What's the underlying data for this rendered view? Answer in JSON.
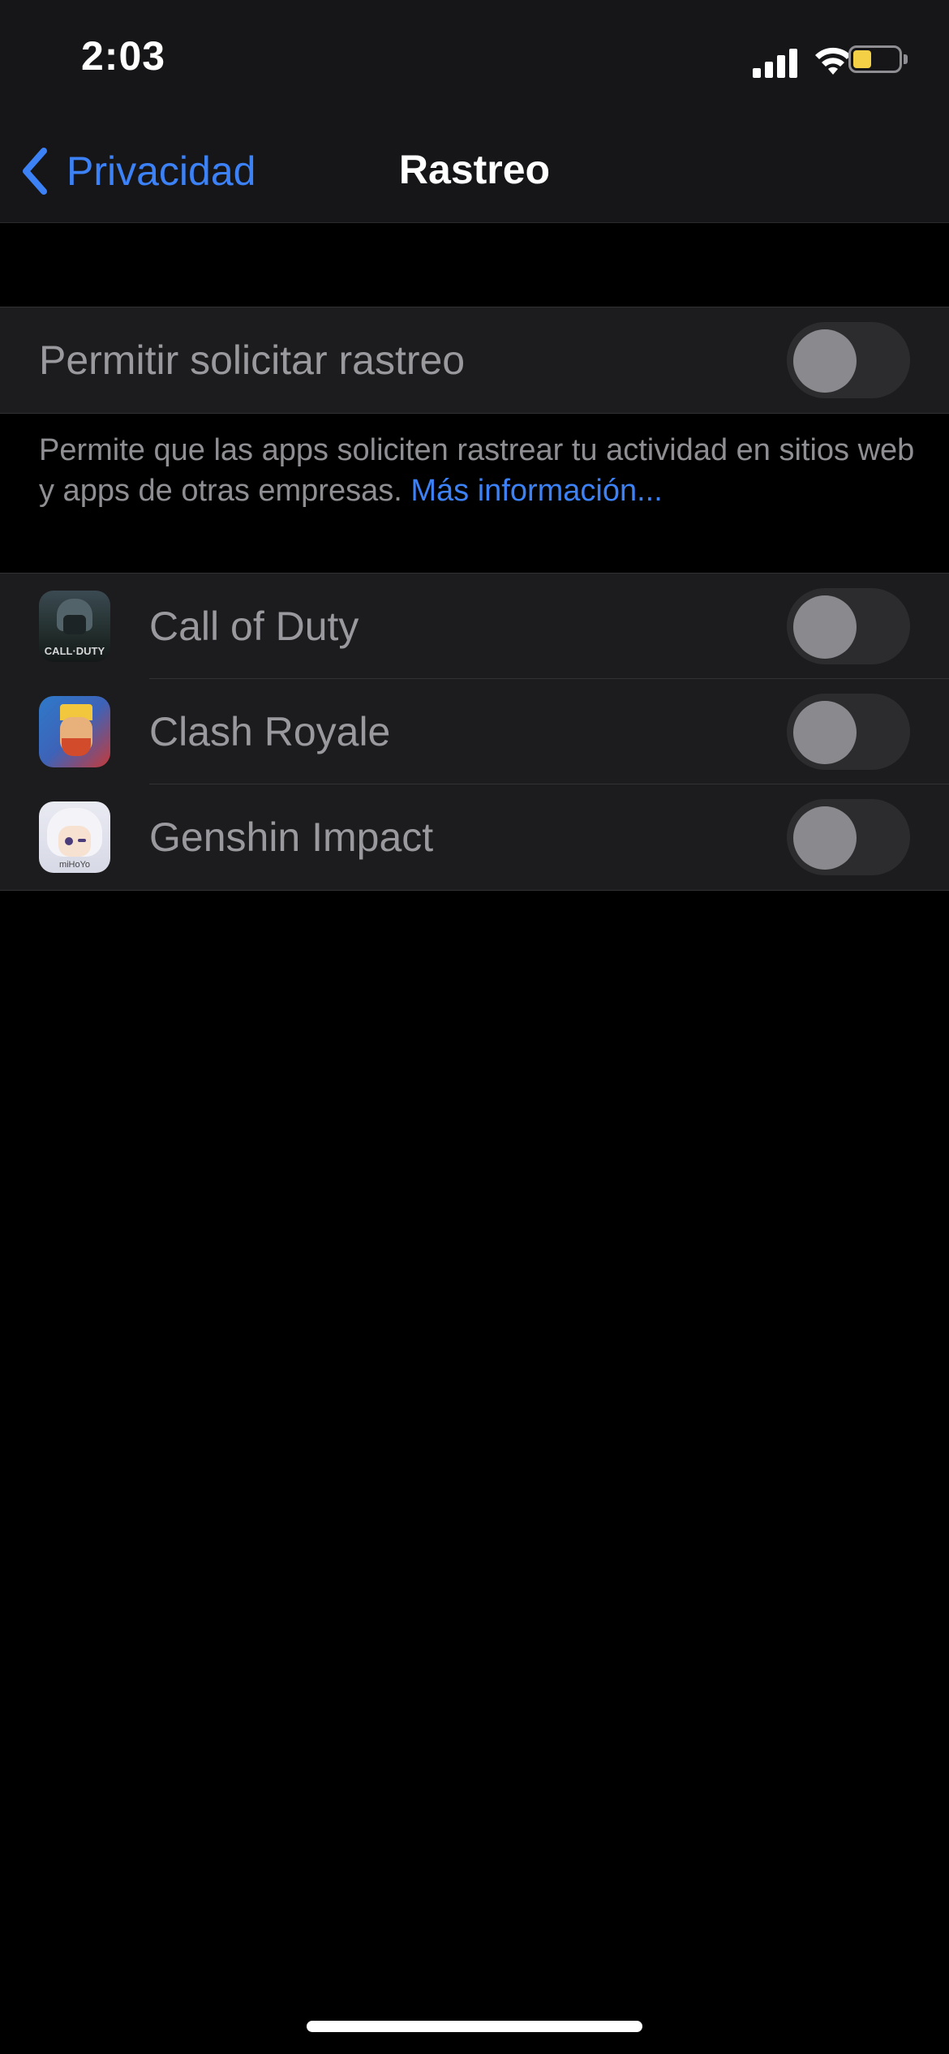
{
  "status_bar": {
    "time": "2:03",
    "icons": [
      "cellular-signal-icon",
      "wifi-icon",
      "battery-icon"
    ],
    "battery_color": "#f4d046"
  },
  "nav": {
    "back_label": "Privacidad",
    "title": "Rastreo",
    "accent_color": "#3c82f6"
  },
  "main_setting": {
    "label": "Permitir solicitar rastreo",
    "enabled": false
  },
  "footer": {
    "text": "Permite que las apps soliciten rastrear tu actividad en sitios web y apps de otras empresas.",
    "link": "Más información..."
  },
  "apps": [
    {
      "name": "Call of Duty",
      "icon": "call-of-duty-app-icon",
      "icon_text": "CALL·DUTY",
      "enabled": false
    },
    {
      "name": "Clash Royale",
      "icon": "clash-royale-app-icon",
      "enabled": false
    },
    {
      "name": "Genshin Impact",
      "icon": "genshin-impact-app-icon",
      "icon_text": "miHoYo",
      "enabled": false
    }
  ]
}
